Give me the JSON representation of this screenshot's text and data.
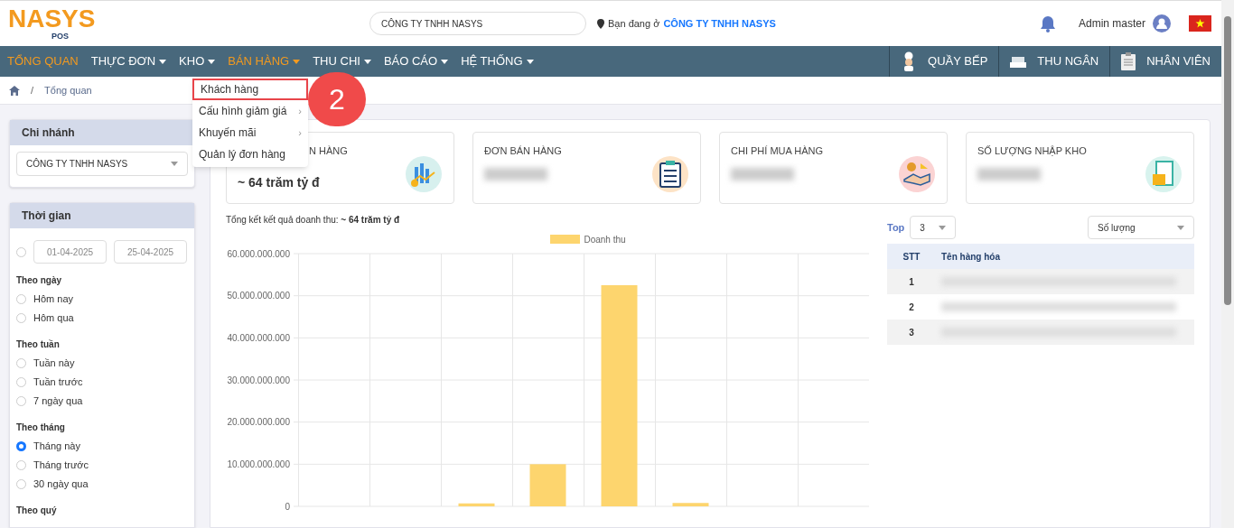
{
  "header": {
    "logo_text": "NASYS",
    "logo_sub": "POS",
    "company_field": "CÔNG TY TNHH NASYS",
    "location_label": "Bạn đang ở",
    "location_value": "CÔNG TY TNHH NASYS",
    "user_name": "Admin master"
  },
  "nav": {
    "items": [
      {
        "label": "TỔNG QUAN",
        "active": true,
        "caret": false
      },
      {
        "label": "THỰC ĐƠN",
        "active": false,
        "caret": true
      },
      {
        "label": "KHO",
        "active": false,
        "caret": true
      },
      {
        "label": "BÁN HÀNG",
        "active": true,
        "caret": true
      },
      {
        "label": "THU CHI",
        "active": false,
        "caret": true
      },
      {
        "label": "BÁO CÁO",
        "active": false,
        "caret": true
      },
      {
        "label": "HỆ THỐNG",
        "active": false,
        "caret": true
      }
    ],
    "right_buttons": [
      {
        "label": "QUẦY BẾP",
        "kind": "chef"
      },
      {
        "label": "THU NGÂN",
        "kind": "register"
      },
      {
        "label": "NHÂN VIÊN",
        "kind": "clipboard"
      }
    ]
  },
  "dropdown": {
    "items": [
      {
        "label": "Khách hàng",
        "highlighted": true,
        "submenu": false
      },
      {
        "label": "Cấu hình giảm giá",
        "highlighted": false,
        "submenu": true
      },
      {
        "label": "Khuyến mãi",
        "highlighted": false,
        "submenu": true
      },
      {
        "label": "Quản lý đơn hàng",
        "highlighted": false,
        "submenu": false
      }
    ],
    "submenu_glyph": "›",
    "step_badge": "2"
  },
  "breadcrumb": {
    "separator": "/",
    "current": "Tổng quan"
  },
  "sidebar": {
    "branch": {
      "title": "Chi nhánh",
      "value": "CÔNG TY TNHH NASYS"
    },
    "time": {
      "title": "Thời gian",
      "custom": {
        "selected": false,
        "from": "01-04-2025",
        "to": "25-04-2025"
      },
      "groups": [
        {
          "title": "Theo ngày",
          "options": [
            {
              "label": "Hôm nay",
              "selected": false
            },
            {
              "label": "Hôm qua",
              "selected": false
            }
          ]
        },
        {
          "title": "Theo tuần",
          "options": [
            {
              "label": "Tuần này",
              "selected": false
            },
            {
              "label": "Tuần trước",
              "selected": false
            },
            {
              "label": "7 ngày qua",
              "selected": false
            }
          ]
        },
        {
          "title": "Theo tháng",
          "options": [
            {
              "label": "Tháng này",
              "selected": true
            },
            {
              "label": "Tháng trước",
              "selected": false
            },
            {
              "label": "30 ngày qua",
              "selected": false
            }
          ]
        },
        {
          "title": "Theo quý"
        }
      ]
    }
  },
  "stat_cards": [
    {
      "title": "N HÀNG",
      "value": "~ 64 trăm tỷ đ",
      "blurred": false
    },
    {
      "title": "ĐƠN BÁN HÀNG",
      "blurred": true
    },
    {
      "title": "CHI PHÍ MUA HÀNG",
      "blurred": true
    },
    {
      "title": "SỐ LƯỢNG NHẬP KHO",
      "blurred": true
    }
  ],
  "summary": {
    "label": "Tổng kết kết quả doanh thu:",
    "value": "~ 64 trăm tỷ đ"
  },
  "chart": {
    "chart_data": {
      "type": "bar",
      "grid": true,
      "series": [
        {
          "name": "Doanh thu",
          "color": "#fdd56e",
          "values": [
            0,
            0,
            700000000,
            10000000000,
            52500000000,
            800000000,
            0,
            0
          ]
        }
      ],
      "ylim": [
        0,
        60000000000
      ],
      "yticks": [
        {
          "value": 0,
          "label": "0"
        },
        {
          "value": 10000000000,
          "label": "10.000.000.000"
        },
        {
          "value": 20000000000,
          "label": "20.000.000.000"
        },
        {
          "value": 30000000000,
          "label": "30.000.000.000"
        },
        {
          "value": 40000000000,
          "label": "40.000.000.000"
        },
        {
          "value": 50000000000,
          "label": "50.000.000.000"
        },
        {
          "value": 60000000000,
          "label": "60.000.000.000"
        }
      ]
    }
  },
  "top_table": {
    "top_label": "Top",
    "top_value": "3",
    "sort_value": "Số lượng",
    "columns": [
      "STT",
      "Tên hàng hóa"
    ],
    "rows": [
      {
        "stt": "1",
        "blurred": true
      },
      {
        "stt": "2",
        "blurred": true
      },
      {
        "stt": "3",
        "blurred": true
      }
    ]
  }
}
